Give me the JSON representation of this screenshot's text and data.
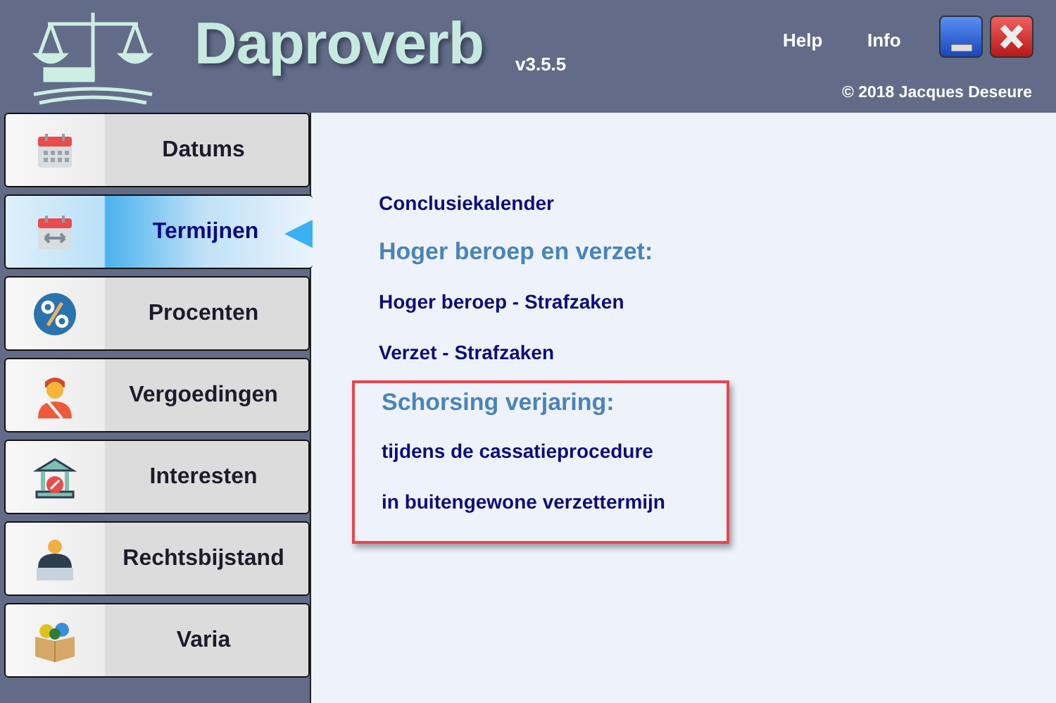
{
  "header": {
    "title": "Daproverb",
    "version": "v3.5.5",
    "menu": [
      "Help",
      "Info"
    ],
    "copyright": "© 2018 Jacques Deseure"
  },
  "sidebar": {
    "items": [
      {
        "label": "Datums",
        "selected": false
      },
      {
        "label": "Termijnen",
        "selected": true
      },
      {
        "label": "Procenten",
        "selected": false
      },
      {
        "label": "Vergoedingen",
        "selected": false
      },
      {
        "label": "Interesten",
        "selected": false
      },
      {
        "label": "Rechtsbijstand",
        "selected": false
      },
      {
        "label": "Varia",
        "selected": false
      }
    ]
  },
  "content": {
    "sections": [
      {
        "highlighted": false,
        "items": [
          "Conclusiekalender"
        ]
      },
      {
        "highlighted": false,
        "heading": "Hoger beroep en verzet:",
        "items": [
          "Hoger beroep - Strafzaken",
          "Verzet - Strafzaken"
        ]
      },
      {
        "highlighted": true,
        "heading": "Schorsing verjaring:",
        "items": [
          "tijdens de cassatieprocedure",
          "in buitengewone verzettermijn"
        ]
      }
    ]
  }
}
